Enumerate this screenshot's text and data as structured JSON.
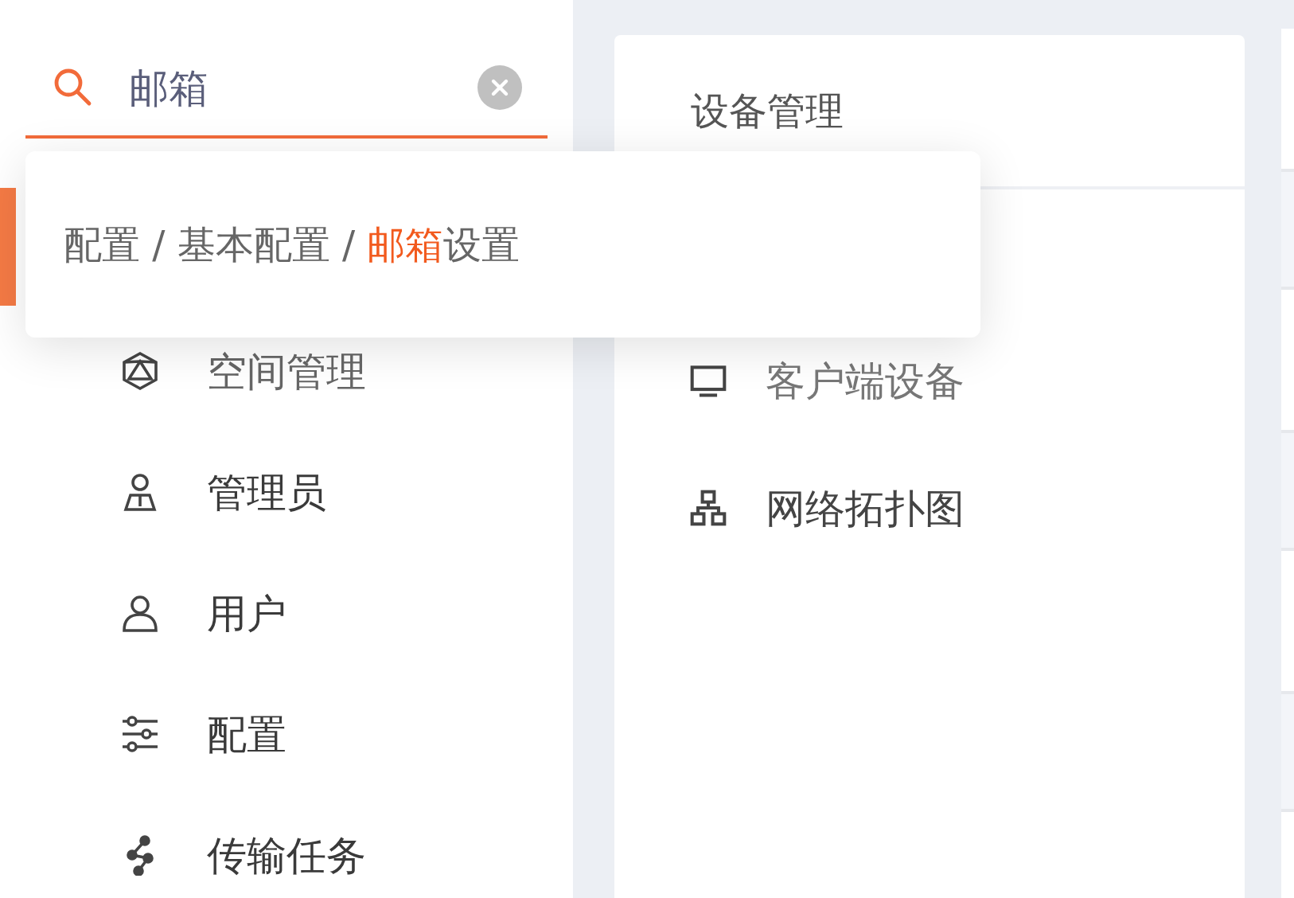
{
  "search": {
    "value": "邮箱"
  },
  "search_results": [
    {
      "text": "配置 / 基本配置 / **邮箱**设置"
    }
  ],
  "sidebar": {
    "items": [
      {
        "label": "空间管理",
        "kind": "space"
      },
      {
        "label": "管理员",
        "kind": "admin"
      },
      {
        "label": "用户",
        "kind": "user"
      },
      {
        "label": "配置",
        "kind": "config"
      },
      {
        "label": "传输任务",
        "kind": "transfer"
      }
    ]
  },
  "device_panel": {
    "title": "设备管理",
    "items": [
      {
        "label": "客户端设备",
        "kind": "monitor"
      },
      {
        "label": "网络拓扑图",
        "kind": "topology"
      }
    ]
  }
}
